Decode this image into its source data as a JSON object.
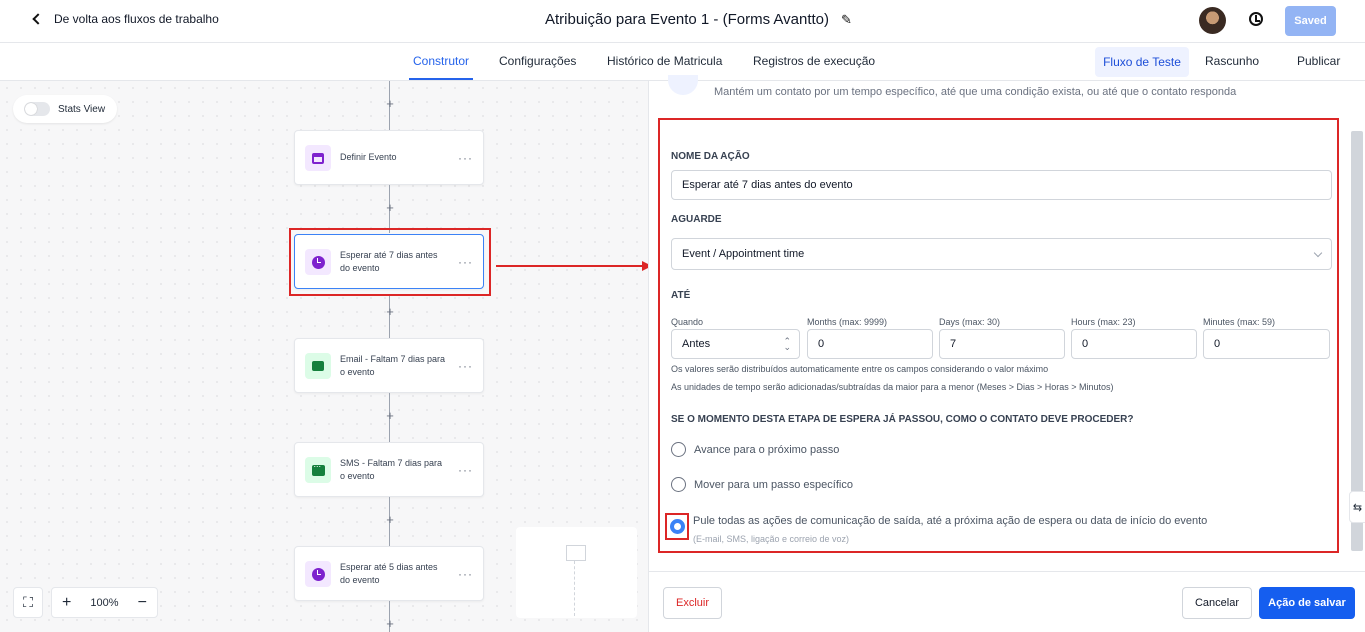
{
  "header": {
    "back_label": "De volta aos fluxos de trabalho",
    "workflow_title": "Atribuição para Evento 1 - (Forms Avantto)",
    "saved_label": "Saved"
  },
  "nav": {
    "tabs": [
      "Construtor",
      "Configurações",
      "Histórico de Matricula",
      "Registros de execução"
    ],
    "active_tab": "Construtor",
    "test_flow_label": "Fluxo de Teste",
    "draft_label": "Rascunho",
    "publish_label": "Publicar"
  },
  "canvas": {
    "stats_view_label": "Stats View",
    "zoom_level": "100%",
    "nodes": [
      {
        "label": "Definir Evento",
        "icon": "calendar-icon"
      },
      {
        "label": "Esperar até 7 dias antes do evento",
        "icon": "clock-icon"
      },
      {
        "label": "Email - Faltam 7 dias para o evento",
        "icon": "email-icon"
      },
      {
        "label": "SMS - Faltam 7 dias para o evento",
        "icon": "sms-icon"
      },
      {
        "label": "Esperar até 5 dias antes do evento",
        "icon": "clock-icon"
      }
    ]
  },
  "panel": {
    "description": "Mantém um contato por um tempo específico, até que uma condição exista, ou até que o contato responda",
    "action_name_label": "NOME DA AÇÃO",
    "action_name_value": "Esperar até 7 dias antes do evento",
    "wait_label": "AGUARDE",
    "wait_value": "Event / Appointment time",
    "until_label": "ATÉ",
    "when_label": "Quando",
    "when_value": "Antes",
    "months_label": "Months (max: 9999)",
    "months_value": "0",
    "days_label": "Days (max: 30)",
    "days_value": "7",
    "hours_label": "Hours (max: 23)",
    "hours_value": "0",
    "minutes_label": "Minutes (max: 59)",
    "minutes_value": "0",
    "hint_1": "Os valores serão distribuídos automaticamente entre os campos considerando o valor máximo",
    "hint_2": "As unidades de tempo serão adicionadas/subtraídas da maior para a menor (Meses > Dias > Horas > Minutos)",
    "past_question": "SE O MOMENTO DESTA ETAPA DE ESPERA JÁ PASSOU, COMO O CONTATO DEVE PROCEDER?",
    "option_1": "Avance para o próximo passo",
    "option_2": "Mover para um passo específico",
    "option_3": "Pule todas as ações de comunicação de saída, até a próxima ação de espera ou data de início do evento",
    "option_3_sub": "(E-mail, SMS, ligação e correio de voz)",
    "selected_option": 3,
    "delete_label": "Excluir",
    "cancel_label": "Cancelar",
    "save_label": "Ação de salvar"
  },
  "colors": {
    "accent": "#155eef",
    "annotation": "#dc2626"
  }
}
